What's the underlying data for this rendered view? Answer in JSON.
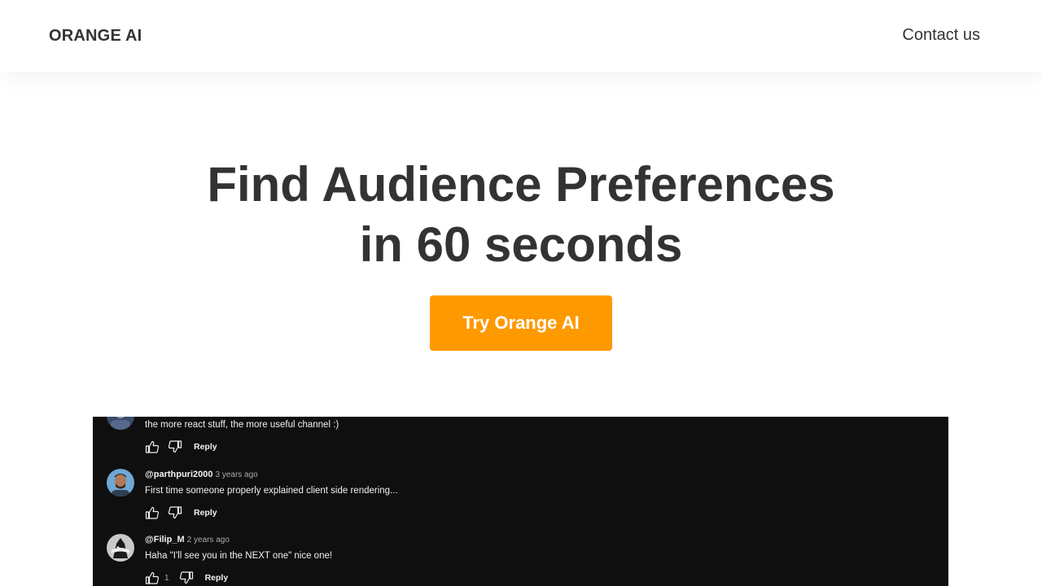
{
  "nav": {
    "brand": "ORANGE AI",
    "contact": "Contact us"
  },
  "hero": {
    "title_line1": "Find Audience Preferences",
    "title_line2": "in 60 seconds",
    "cta": "Try Orange AI"
  },
  "colors": {
    "accent": "#ff9900",
    "text": "#333333",
    "video_bg": "#0f0f0f"
  },
  "comments": [
    {
      "handle": "",
      "age": "",
      "text": "the more react stuff, the more useful channel :)",
      "likes": "",
      "reply": "Reply"
    },
    {
      "handle": "@parthpuri2000",
      "age": "3 years ago",
      "text": "First time someone properly explained client side rendering...",
      "likes": "",
      "reply": "Reply"
    },
    {
      "handle": "@Filip_M",
      "age": "2 years ago",
      "text": "Haha \"I'll see you in the NEXT one\" nice one!",
      "likes": "1",
      "reply": "Reply"
    }
  ],
  "icons": {
    "like": "thumbs-up-icon",
    "dislike": "thumbs-down-icon"
  }
}
